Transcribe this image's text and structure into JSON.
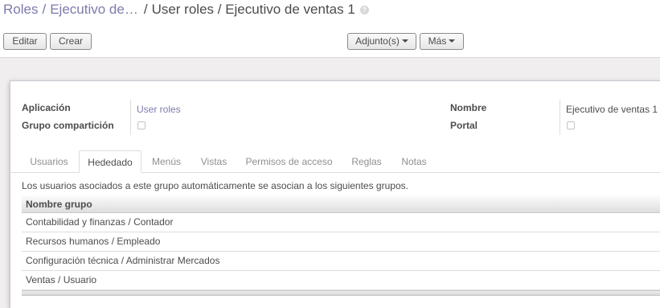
{
  "breadcrumb": {
    "items": [
      "Roles",
      "Ejecutivo de…"
    ],
    "current": "User roles / Ejecutivo de ventas 1",
    "help_icon": "?"
  },
  "toolbar": {
    "edit_label": "Editar",
    "create_label": "Crear",
    "attachments_label": "Adjunto(s)",
    "more_label": "Más"
  },
  "form": {
    "application_label": "Aplicación",
    "application_value": "User roles",
    "share_group_label": "Grupo compartición",
    "share_group_checked": false,
    "name_label": "Nombre",
    "name_value": "Ejecutivo de ventas 1",
    "portal_label": "Portal",
    "portal_checked": false
  },
  "tabs": [
    {
      "label": "Usuarios",
      "active": false
    },
    {
      "label": "Hededado",
      "active": true
    },
    {
      "label": "Menús",
      "active": false
    },
    {
      "label": "Vistas",
      "active": false
    },
    {
      "label": "Permisos de acceso",
      "active": false
    },
    {
      "label": "Reglas",
      "active": false
    },
    {
      "label": "Notas",
      "active": false
    }
  ],
  "inherited": {
    "description": "Los usuarios asociados a este grupo automáticamente se asocian a los siguientes grupos.",
    "column_header": "Nombre grupo",
    "rows": [
      "Contabilidad y finanzas / Contador",
      "Recursos humanos / Empleado",
      "Configuración técnica / Administrar Mercados",
      "Ventas / Usuario"
    ]
  },
  "colors": {
    "link": "#7c7bad",
    "text": "#4c4c4c",
    "background": "#f0eeee"
  }
}
